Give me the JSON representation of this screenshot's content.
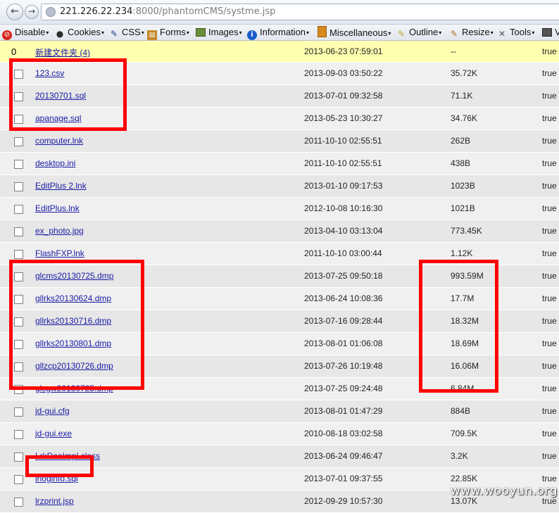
{
  "browser": {
    "url_host": "221.226.22.234",
    "url_rest": ":8000/phantomCMS/systme.jsp"
  },
  "toolbar": {
    "items": [
      {
        "label": "Disable",
        "icon": "disable-icon"
      },
      {
        "label": "Cookies",
        "icon": "cookies-icon"
      },
      {
        "label": "CSS",
        "icon": "css-icon"
      },
      {
        "label": "Forms",
        "icon": "forms-icon"
      },
      {
        "label": "Images",
        "icon": "images-icon"
      },
      {
        "label": "Information",
        "icon": "information-icon"
      },
      {
        "label": "Miscellaneous",
        "icon": "miscellaneous-icon"
      },
      {
        "label": "Outline",
        "icon": "outline-icon"
      },
      {
        "label": "Resize",
        "icon": "resize-icon"
      },
      {
        "label": "Tools",
        "icon": "tools-icon"
      },
      {
        "label": "V",
        "icon": "view-source-icon"
      }
    ]
  },
  "folder": {
    "num": "0",
    "name": "新建文件夹 (4)",
    "date": "2013-06-23 07:59:01",
    "size": "--",
    "flag": "true"
  },
  "files": [
    {
      "name": "123.csv",
      "date": "2013-09-03 03:50:22",
      "size": "35.72K",
      "flag": "true"
    },
    {
      "name": "20130701.sql",
      "date": "2013-07-01 09:32:58",
      "size": "71.1K",
      "flag": "true"
    },
    {
      "name": "apanage.sql",
      "date": "2013-05-23 10:30:27",
      "size": "34.76K",
      "flag": "true"
    },
    {
      "name": "computer.lnk",
      "date": "2011-10-10 02:55:51",
      "size": "262B",
      "flag": "true"
    },
    {
      "name": "desktop.ini",
      "date": "2011-10-10 02:55:51",
      "size": "438B",
      "flag": "true"
    },
    {
      "name": "EditPlus 2.lnk",
      "date": "2013-01-10 09:17:53",
      "size": "1023B",
      "flag": "true"
    },
    {
      "name": "EditPlus.lnk",
      "date": "2012-10-08 10:16:30",
      "size": "1021B",
      "flag": "true"
    },
    {
      "name": "ex_photo.jpg",
      "date": "2013-04-10 03:13:04",
      "size": "773.45K",
      "flag": "true"
    },
    {
      "name": "FlashFXP.lnk",
      "date": "2011-10-10 03:00:44",
      "size": "1.12K",
      "flag": "true"
    },
    {
      "name": "glcms20130725.dmp",
      "date": "2013-07-25 09:50:18",
      "size": "993.59M",
      "flag": "true"
    },
    {
      "name": "gllrks20130624.dmp",
      "date": "2013-06-24 10:08:36",
      "size": "17.7M",
      "flag": "true"
    },
    {
      "name": "gllrks20130716.dmp",
      "date": "2013-07-16 09:28:44",
      "size": "18.32M",
      "flag": "true"
    },
    {
      "name": "gllrks20130801.dmp",
      "date": "2013-08-01 01:06:08",
      "size": "18.69M",
      "flag": "true"
    },
    {
      "name": "gllzcp20130726.dmp",
      "date": "2013-07-26 10:19:48",
      "size": "16.06M",
      "flag": "true"
    },
    {
      "name": "glsgw20130725.dmp",
      "date": "2013-07-25 09:24:48",
      "size": "6.84M",
      "flag": "true"
    },
    {
      "name": "jd-gui.cfg",
      "date": "2013-08-01 01:47:29",
      "size": "884B",
      "flag": "true"
    },
    {
      "name": "jd-gui.exe",
      "date": "2010-08-18 03:02:58",
      "size": "709.5K",
      "flag": "true"
    },
    {
      "name": "LrkDaoImpl.class",
      "date": "2013-06-24 09:46:47",
      "size": "3.2K",
      "flag": "true"
    },
    {
      "name": "lrloginfo.sql",
      "date": "2013-07-01 09:37:55",
      "size": "22.85K",
      "flag": "true"
    },
    {
      "name": "lrzprint.jsp",
      "date": "2012-09-29 10:57:30",
      "size": "13.07K",
      "flag": "true"
    }
  ],
  "watermark": "www.wooyun.org",
  "colors": {
    "highlight": "#ff0000",
    "link": "#1a1aa6",
    "folder_row": "#ffffb0"
  }
}
